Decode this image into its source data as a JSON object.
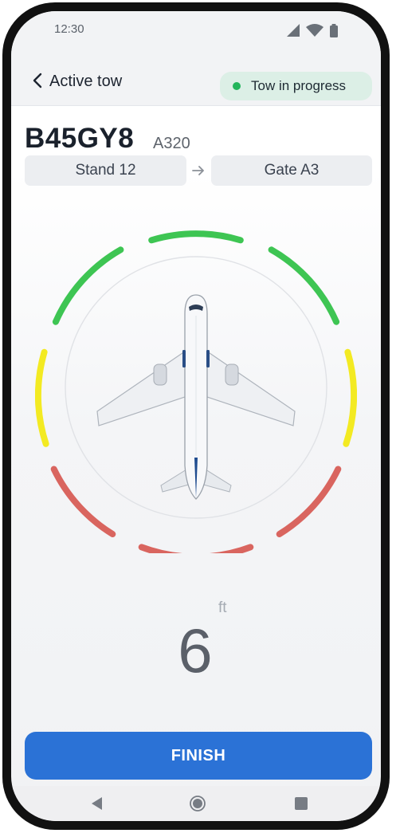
{
  "status_bar": {
    "time": "12:30",
    "icons": [
      "signal-icon",
      "wifi-icon",
      "battery-icon"
    ]
  },
  "header": {
    "title": "Active tow",
    "status_badge": {
      "label": "Tow in progress",
      "color": "#22b55b"
    }
  },
  "aircraft": {
    "registration": "B45GY8",
    "type": "A320"
  },
  "route": {
    "from": "Stand 12",
    "to": "Gate A3"
  },
  "proximity": {
    "distance": "6",
    "unit": "ft",
    "zone_colors": {
      "safe": "#3ec553",
      "caution": "#f3ea22",
      "danger": "#d9655f"
    }
  },
  "actions": {
    "finish_label": "FINISH",
    "finish_color": "#2b72d6"
  },
  "nav": {
    "icons": [
      "back-triangle-icon",
      "home-circle-icon",
      "recents-square-icon"
    ]
  }
}
